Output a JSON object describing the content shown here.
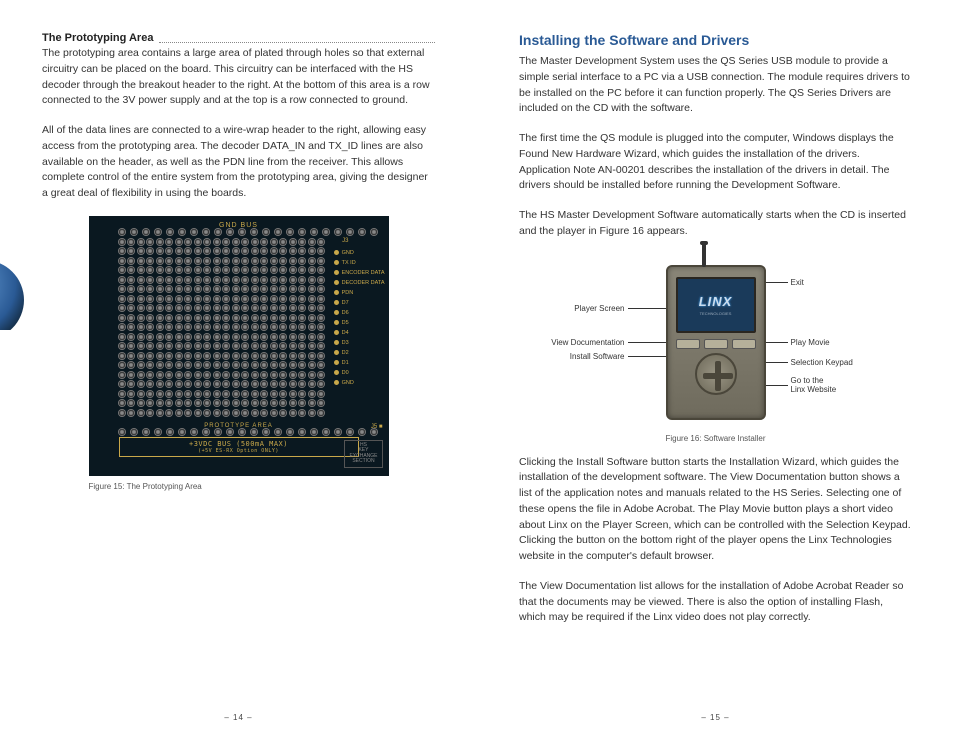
{
  "left_page": {
    "section_title": "The Prototyping Area",
    "para1": "The prototyping area contains a large area of plated through holes so that external circuitry can be placed on the board. This circuitry can be interfaced with the HS decoder through the breakout header to the right. At the bottom of this area is a row connected to the 3V power supply and at the top is a row connected to ground.",
    "para2": "All of the data lines are connected to a wire-wrap header to the right, allowing easy access from the prototyping area. The decoder DATA_IN and TX_ID lines are also available on the header, as well as the PDN line from the receiver. This allows complete control of the entire system from the prototyping area, giving the designer a great deal of flexibility in using the boards.",
    "board": {
      "gnd_bus": "GND BUS",
      "side_pins": [
        "GND",
        "TX ID",
        "ENCODER DATA",
        "DECODER DATA",
        "PDN",
        "D7",
        "D6",
        "D5",
        "D4",
        "D3",
        "D2",
        "D1",
        "D0",
        "GND"
      ],
      "proto_label": "PROTOTYPE AREA",
      "vbus": "+3VDC BUS (500mA MAX)",
      "vbus_sub": "(+5V ES-RX Option ONLY)",
      "hs_key": "HS\nKEY\nEXCHANGE\nSECTION",
      "j3": "J3",
      "j5": "J5 ■"
    },
    "fig_caption": "Figure 15: The Prototyping Area",
    "page_num": "– 14 –"
  },
  "right_page": {
    "heading": "Installing the Software and Drivers",
    "para1": "The Master Development System uses the QS Series USB module to provide a simple serial interface to a PC via a USB connection. The module requires drivers to be installed on the PC before it can function properly. The QS Series Drivers are included on the CD with the software.",
    "para2": "The first time the QS module is plugged into the computer, Windows displays the Found New Hardware Wizard, which guides the installation of the drivers. Application Note AN-00201 describes the installation of the drivers in detail. The drivers should be installed before running the Development Software.",
    "para3": "The HS Master Development Software automatically starts when the CD is inserted and the player in Figure 16 appears.",
    "callouts": {
      "exit": "Exit",
      "player_screen": "Player Screen",
      "view_doc": "View Documentation",
      "install_sw": "Install Software",
      "play_movie": "Play Movie",
      "sel_keypad": "Selection Keypad",
      "goto_web": "Go to the\nLinx Website"
    },
    "device": {
      "logo": "LINX",
      "logo_sub": "TECHNOLOGIES"
    },
    "fig_caption": "Figure 16: Software Installer",
    "para4": "Clicking the Install Software button starts the Installation Wizard, which guides the installation of the development software. The View Documentation button shows a list of the application notes and manuals related to the HS Series. Selecting one of these opens the file in Adobe Acrobat. The Play Movie button plays a short video about Linx on the Player Screen, which can be controlled with the Selection Keypad. Clicking the button on the bottom right of the player opens the Linx Technologies website in the computer's default browser.",
    "para5": "The View Documentation list allows for the installation of Adobe Acrobat Reader so that the documents may be viewed. There is also the option of installing Flash, which may be required if the Linx video does not play correctly.",
    "page_num": "– 15 –"
  }
}
